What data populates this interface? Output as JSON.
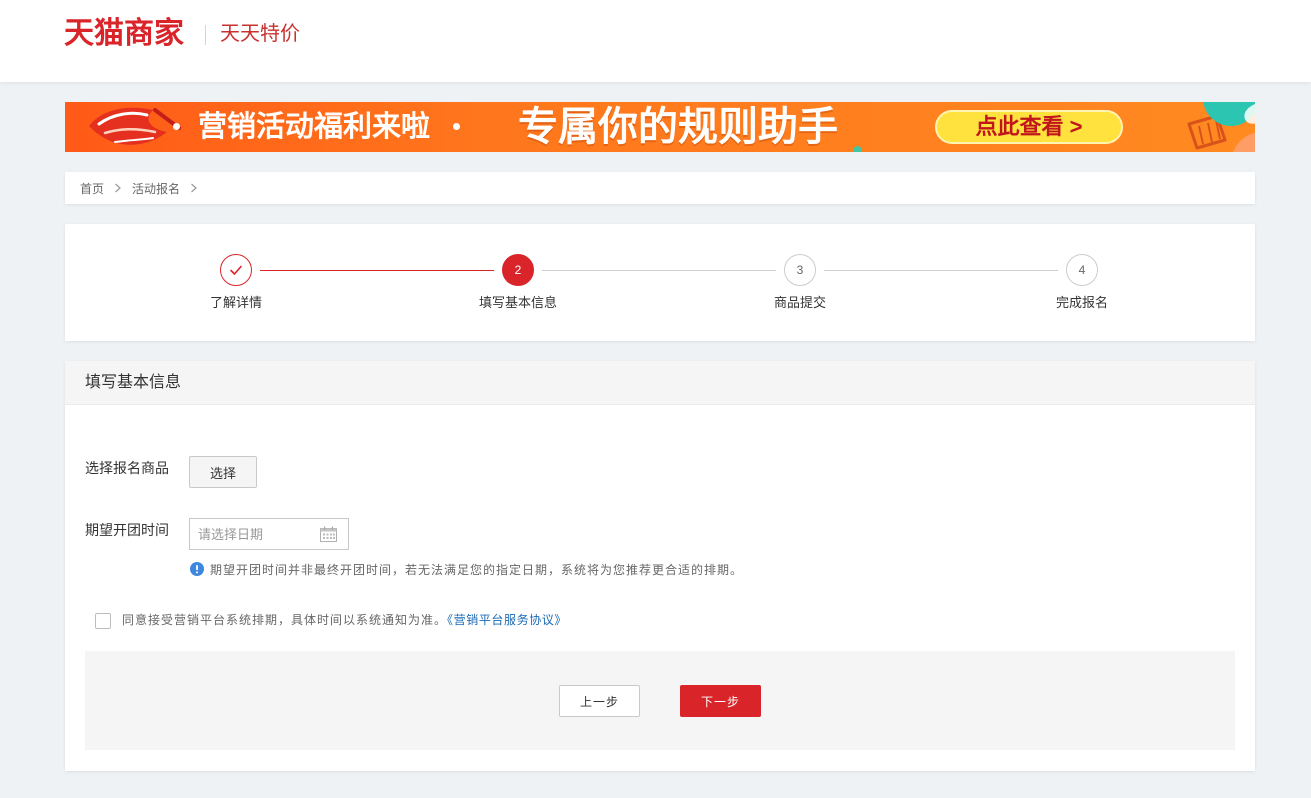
{
  "colors": {
    "brand_red": "#d9252a",
    "link_blue": "#1a6ab5",
    "info_blue": "#3d87de",
    "banner_from": "#ff5a17",
    "banner_to": "#ff8a20",
    "cta_yellow": "#ffe23d"
  },
  "header": {
    "logo": "天猫商家",
    "subtitle": "天天特价"
  },
  "banner": {
    "headline": "营销活动福利来啦",
    "title": "专属你的规则助手",
    "cta": "点此查看 >"
  },
  "breadcrumb": [
    {
      "label": "首页"
    },
    {
      "label": "活动报名"
    }
  ],
  "steps": [
    {
      "label": "了解详情",
      "icon": "check-icon",
      "completed": true,
      "current": false
    },
    {
      "label": "填写基本信息",
      "number": "2",
      "completed": false,
      "current": true
    },
    {
      "label": "商品提交",
      "number": "3",
      "completed": false,
      "current": false
    },
    {
      "label": "完成报名",
      "number": "4",
      "completed": false,
      "current": false
    }
  ],
  "form": {
    "title": "填写基本信息",
    "product": {
      "label": "选择报名商品",
      "button": "选择"
    },
    "date": {
      "label": "期望开团时间",
      "placeholder": "请选择日期",
      "icon": "calendar-icon"
    },
    "hint": {
      "icon": "info-icon",
      "text": "期望开团时间并非最终开团时间，若无法满足您的指定日期，系统将为您推荐更合适的排期。"
    },
    "agreement": {
      "checked": false,
      "text": "同意接受营销平台系统排期，具体时间以系统通知为准。",
      "link": "《营销平台服务协议》"
    }
  },
  "actions": {
    "prev": "上一步",
    "next": "下一步"
  }
}
